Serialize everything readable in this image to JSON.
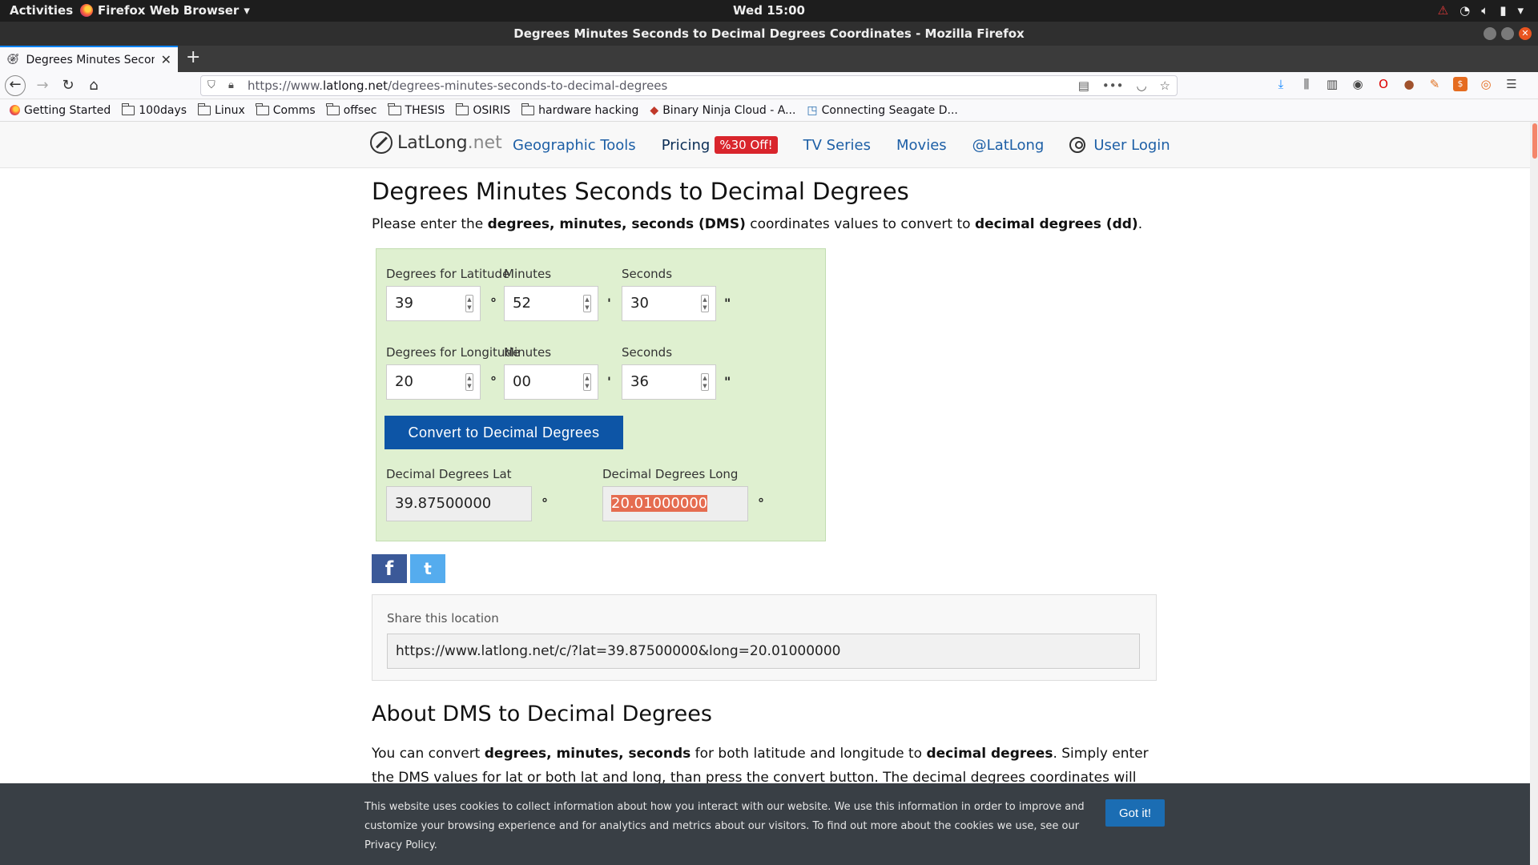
{
  "system": {
    "activities": "Activities",
    "app_menu": "Firefox Web Browser",
    "clock": "Wed 15:00"
  },
  "window": {
    "title": "Degrees Minutes Seconds to Decimal Degrees Coordinates - Mozilla Firefox"
  },
  "tab": {
    "title": "Degrees Minutes Seconds to Decimal Degrees Coordinates"
  },
  "navbar": {
    "url_prefix": "https://www.",
    "url_domain": "latlong.net",
    "url_path": "/degrees-minutes-seconds-to-decimal-degrees"
  },
  "bookmarks": [
    {
      "label": "Getting Started",
      "icon": "firefox-icon"
    },
    {
      "label": "100days",
      "icon": "folder-icon"
    },
    {
      "label": "Linux",
      "icon": "folder-icon"
    },
    {
      "label": "Comms",
      "icon": "folder-icon"
    },
    {
      "label": "offsec",
      "icon": "folder-icon"
    },
    {
      "label": "THESIS",
      "icon": "folder-icon"
    },
    {
      "label": "OSIRIS",
      "icon": "folder-icon"
    },
    {
      "label": "hardware hacking",
      "icon": "folder-icon"
    },
    {
      "label": "Binary Ninja Cloud - A...",
      "icon": "binja-icon"
    },
    {
      "label": "Connecting Seagate D...",
      "icon": "page-icon"
    }
  ],
  "site": {
    "brand_main": "LatLong",
    "brand_suffix": ".net",
    "nav": {
      "geo_tools": "Geographic Tools",
      "pricing": "Pricing",
      "pricing_badge": "%30 Off!",
      "tv_series": "TV Series",
      "movies": "Movies",
      "twitter": "@LatLong",
      "login": "User Login"
    }
  },
  "page": {
    "title": "Degrees Minutes Seconds to Decimal Degrees",
    "intro_1": "Please enter the ",
    "intro_b1": "degrees, minutes, seconds (DMS)",
    "intro_2": " coordinates values to convert to ",
    "intro_b2": "decimal degrees (dd)",
    "intro_3": "."
  },
  "converter": {
    "lat_deg_label": "Degrees for Latitude",
    "lat_min_label": "Minutes",
    "lat_sec_label": "Seconds",
    "lat_deg": "39",
    "lat_min": "52",
    "lat_sec": "30",
    "lon_deg_label": "Degrees for Longitude",
    "lon_min_label": "Minutes",
    "lon_sec_label": "Seconds",
    "lon_deg": "20",
    "lon_min": "00",
    "lon_sec": "36",
    "unit_deg": "°",
    "unit_min": "'",
    "unit_sec": "\"",
    "convert_button": "Convert to Decimal Degrees",
    "dd_lat_label": "Decimal Degrees Lat",
    "dd_long_label": "Decimal Degrees Long",
    "dd_lat": "39.87500000",
    "dd_long": "20.01000000"
  },
  "share": {
    "facebook": "f",
    "twitter": "t",
    "label": "Share this location",
    "url": "https://www.latlong.net/c/?lat=39.87500000&long=20.01000000"
  },
  "about": {
    "title": "About DMS to Decimal Degrees",
    "p1": "You can convert ",
    "b1": "degrees, minutes, seconds",
    "p2": " for both latitude and longitude to ",
    "b2": "decimal degrees",
    "p3": ". Simply enter the DMS values for lat or both lat and long, than press the convert button. The decimal degrees coordinates will be calculated and"
  },
  "cookie": {
    "text": "This website uses cookies to collect information about how you interact with our website. We use this information in order to improve and customize your browsing experience and for analytics and metrics about our visitors. To find out more about the cookies we use, see our Privacy Policy.",
    "button": "Got it!"
  }
}
